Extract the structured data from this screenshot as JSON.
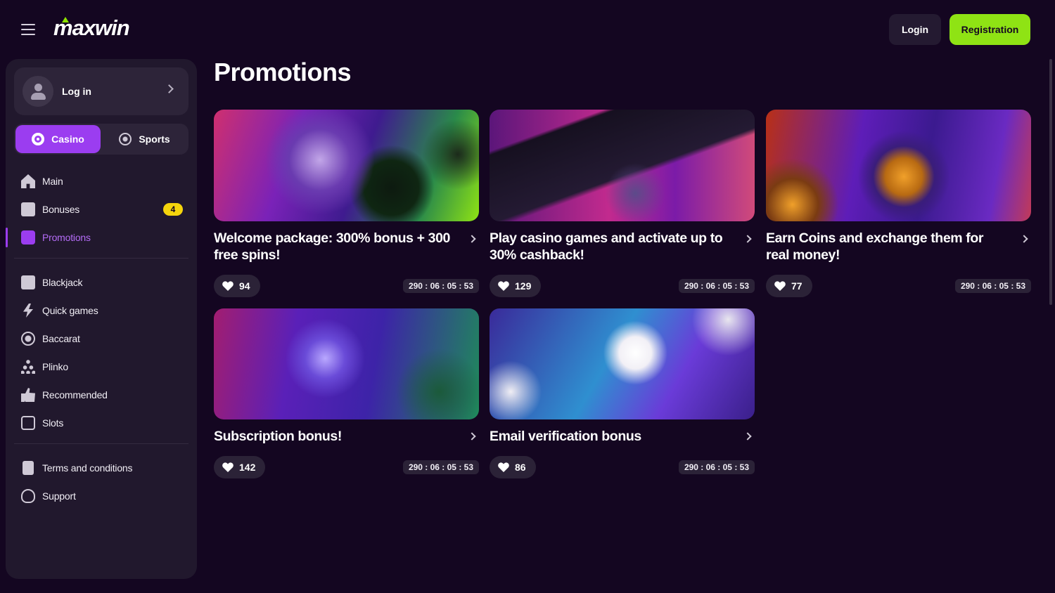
{
  "header": {
    "logo": "maxwin",
    "login_label": "Login",
    "registration_label": "Registration"
  },
  "sidebar": {
    "login_label": "Log in",
    "tabs": {
      "casino": "Casino",
      "sports": "Sports"
    },
    "items": [
      {
        "label": "Main",
        "icon": "home-icon"
      },
      {
        "label": "Bonuses",
        "icon": "gift-icon",
        "badge": "4"
      },
      {
        "label": "Promotions",
        "icon": "promotions-icon",
        "active": true
      },
      {
        "label": "Blackjack",
        "icon": "blackjack-icon"
      },
      {
        "label": "Quick games",
        "icon": "lightning-icon"
      },
      {
        "label": "Baccarat",
        "icon": "baccarat-icon"
      },
      {
        "label": "Plinko",
        "icon": "plinko-icon"
      },
      {
        "label": "Recommended",
        "icon": "thumbs-up-icon"
      },
      {
        "label": "Slots",
        "icon": "slots-icon"
      },
      {
        "label": "Terms and conditions",
        "icon": "document-icon"
      },
      {
        "label": "Support",
        "icon": "headset-icon"
      }
    ]
  },
  "main": {
    "title": "Promotions",
    "cards": [
      {
        "title": "Welcome package: 300% bonus + 300 free spins!",
        "likes": "94",
        "timer": "290 : 06 : 05 : 53"
      },
      {
        "title": "Play casino games and activate up to 30% cashback!",
        "likes": "129",
        "timer": "290 : 06 : 05 : 53"
      },
      {
        "title": "Earn Coins and exchange them for real money!",
        "likes": "77",
        "timer": "290 : 06 : 05 : 53"
      },
      {
        "title": "Subscription bonus!",
        "likes": "142",
        "timer": "290 : 06 : 05 : 53"
      },
      {
        "title": "Email verification bonus",
        "likes": "86",
        "timer": "290 : 06 : 05 : 53"
      }
    ]
  },
  "colors": {
    "background": "#140621",
    "sidebar": "#21182d",
    "accent_purple": "#9b3df0",
    "accent_green": "#8fe314",
    "badge_yellow": "#f5d40c"
  }
}
